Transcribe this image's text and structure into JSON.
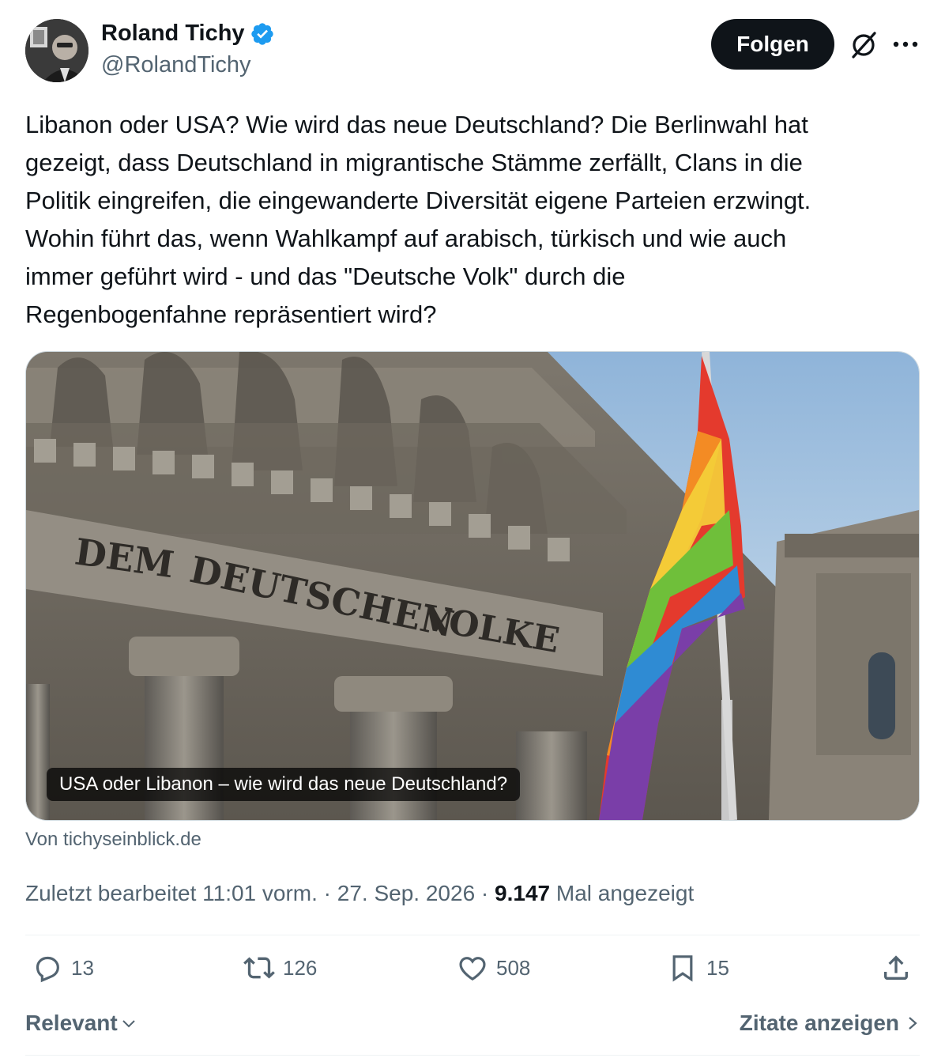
{
  "author": {
    "display_name": "Roland Tichy",
    "handle": "@RolandTichy",
    "verified": true
  },
  "header": {
    "follow_label": "Folgen"
  },
  "tweet": {
    "text": "Libanon oder USA? Wie wird das neue Deutschland? Die Berlinwahl hat\ngezeigt, dass Deutschland in migrantische Stämme zerfällt, Clans in die\nPolitik eingreifen, die eingewanderte Diversität eigene Parteien erzwingt.\nWohin führt das, wenn Wahlkampf auf arabisch, türkisch und wie auch\nimmer geführt wird - und das \"Deutsche Volk\" durch die\nRegenbogenfahne repräsentiert wird?"
  },
  "media": {
    "inscription_words": [
      "DEM",
      "DEUTSCHEN",
      "VOLKE"
    ],
    "caption": "USA oder Libanon – wie wird das neue Deutschland?",
    "source": "Von tichyseinblick.de"
  },
  "meta": {
    "edited_prefix": "Zuletzt bearbeitet 11:01 vorm. · 27. Sep. 2026 · ",
    "views_count": "9.147",
    "views_suffix": " Mal angezeigt"
  },
  "actions": {
    "replies": "13",
    "reposts": "126",
    "likes": "508",
    "bookmarks": "15"
  },
  "footer": {
    "sort_label": "Relevant",
    "quotes_label": "Zitate anzeigen"
  },
  "colors": {
    "verified": "#1d9bf0",
    "text": "#0f1419",
    "muted": "#536471"
  },
  "icons": [
    "verified-badge-icon",
    "grok-icon",
    "more-icon",
    "reply-icon",
    "repost-icon",
    "like-icon",
    "bookmark-icon",
    "share-icon",
    "chevron-down-icon",
    "chevron-right-icon"
  ]
}
